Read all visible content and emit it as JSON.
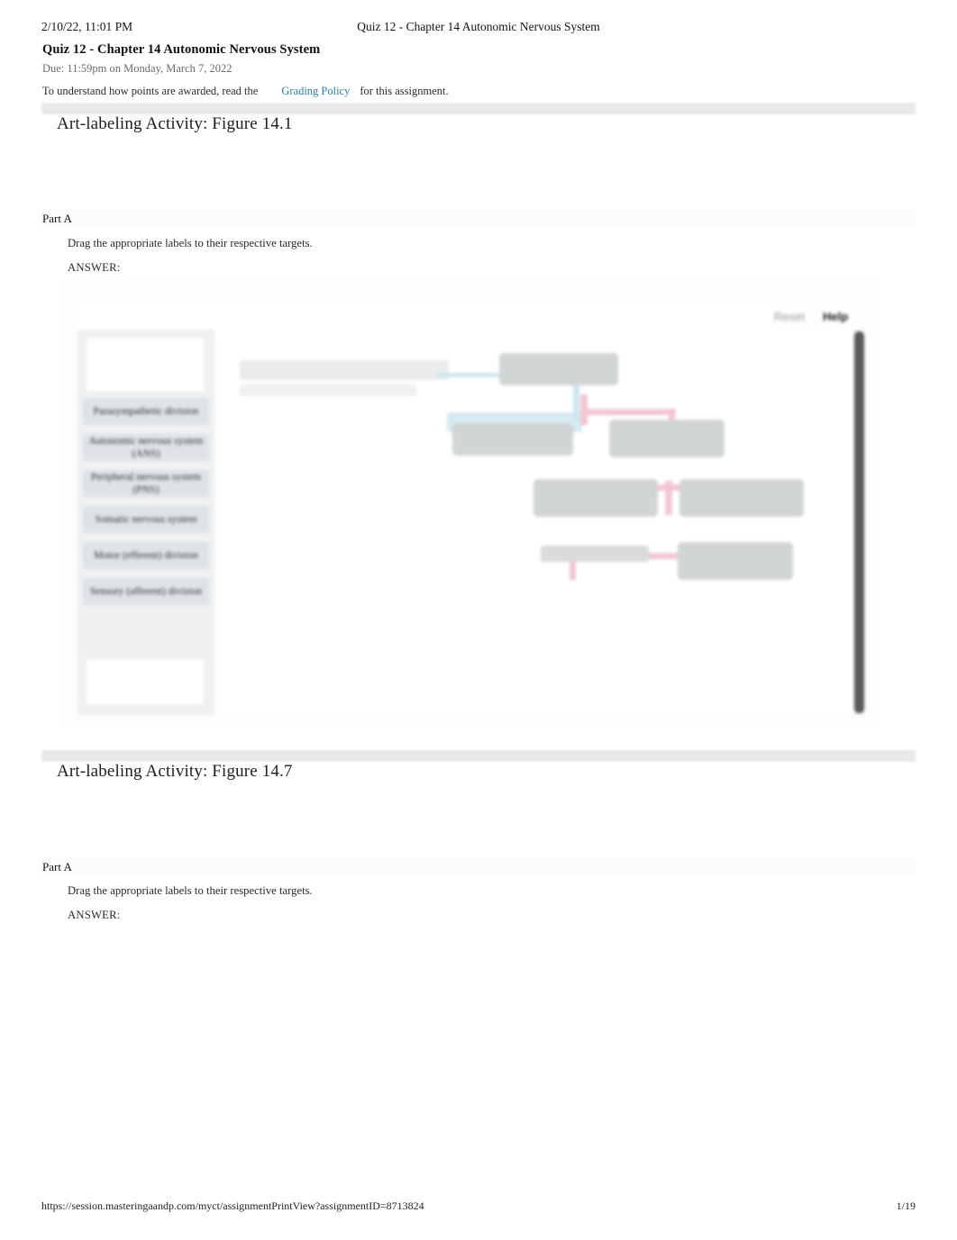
{
  "print_header": {
    "date": "2/10/22, 11:01 PM",
    "title": "Quiz 12 - Chapter 14 Autonomic Nervous System"
  },
  "document": {
    "title": "Quiz 12 - Chapter 14 Autonomic Nervous System",
    "due": "Due: 11:59pm on Monday, March 7, 2022",
    "policy_prefix": "To understand how points are awarded, read the",
    "policy_link": "Grading Policy",
    "policy_suffix": "for this assignment."
  },
  "sections": [
    {
      "activity_title": "Art-labeling Activity: Figure 14.1",
      "part_label": "Part A",
      "instruction": "Drag the appropriate labels to their respective targets.",
      "answer_label": "ANSWER:"
    },
    {
      "activity_title": "Art-labeling Activity: Figure 14.7",
      "part_label": "Part A",
      "instruction": "Drag the appropriate labels to their respective targets.",
      "answer_label": "ANSWER:"
    }
  ],
  "widget": {
    "reset_label": "Reset",
    "help_label": "Help",
    "labels": [
      "Parasympathetic division",
      "Autonomic nervous system (ANS)",
      "Peripheral nervous system (PNS)",
      "Somatic nervous system",
      "Motor (efferent) division",
      "Sensory (afferent) division"
    ]
  },
  "footer": {
    "url": "https://session.masteringaandp.com/myct/assignmentPrintView?assignmentID=8713824",
    "page": "1/19"
  },
  "colors": {
    "link": "#2980a8",
    "band": "#e9e9e9",
    "chip": "#dfe3e6",
    "bank": "#eef0f2",
    "diagram_box": "#d2d5d6",
    "connector_pink": "#f2c6d2",
    "connector_blue": "#cfe6ef",
    "scrollbar": "#5c5c5c"
  }
}
